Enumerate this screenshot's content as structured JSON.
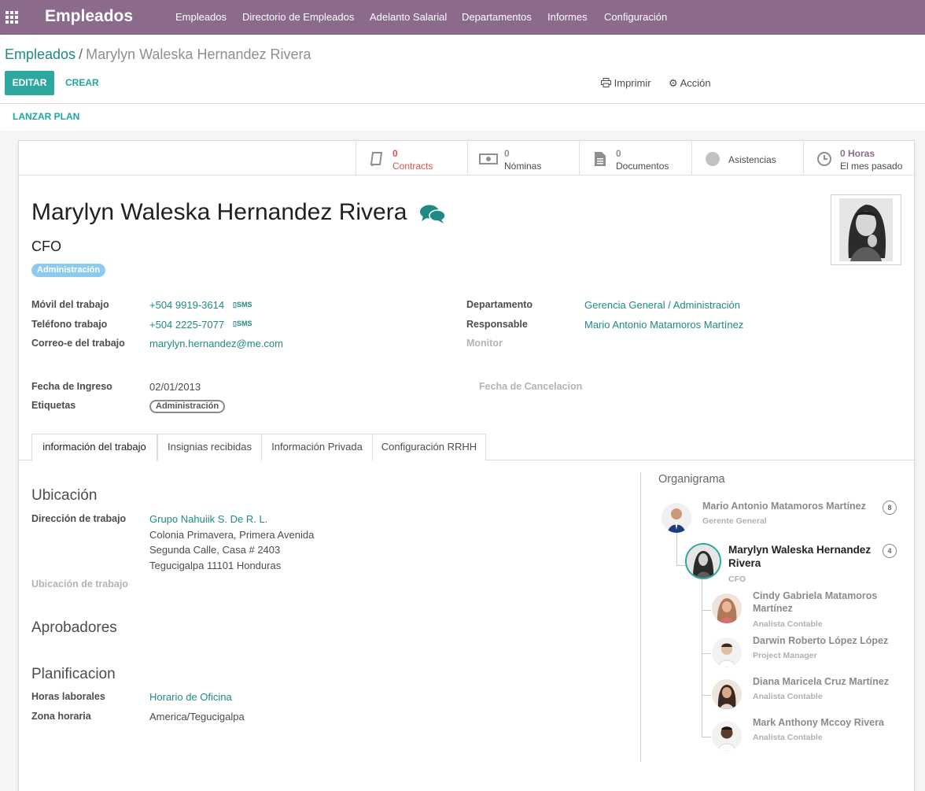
{
  "navbar": {
    "brand": "Empleados",
    "menu": [
      "Empleados",
      "Directorio de Empleados",
      "Adelanto Salarial",
      "Departamentos",
      "Informes",
      "Configuración"
    ]
  },
  "breadcrumb": {
    "parent": "Empleados",
    "separator": "/",
    "current": "Marylyn Waleska Hernandez Rivera"
  },
  "toolbar": {
    "edit": "EDITAR",
    "create": "CREAR",
    "print": "Imprimir",
    "action": "Acción",
    "launch_plan": "LANZAR PLAN"
  },
  "smart_buttons": [
    {
      "number": "0",
      "label": "Contracts",
      "icon": "book-icon",
      "color": "#d9534f"
    },
    {
      "number": "0",
      "label": "Nóminas",
      "icon": "money-icon",
      "color": "#8f8f8f"
    },
    {
      "number": "0",
      "label": "Documentos",
      "icon": "document-icon",
      "color": "#8f8f8f"
    },
    {
      "number": "",
      "label": "Asistencias",
      "icon": "presence-dot-icon",
      "color": "#8f8f8f"
    },
    {
      "number": "0 Horas",
      "label": "El mes pasado",
      "icon": "clock-icon",
      "color": "#8b6a8c"
    }
  ],
  "employee": {
    "name": "Marylyn Waleska Hernandez Rivera",
    "job_title": "CFO",
    "tag": "Administración"
  },
  "fields": {
    "mobile_label": "Móvil del trabajo",
    "mobile": "+504 9919-3614",
    "phone_label": "Teléfono trabajo",
    "phone": "+504 2225-7077",
    "email_label": "Correo-e del trabajo",
    "email": "marylyn.hernandez@me.com",
    "sms": "SMS",
    "department_label": "Departamento",
    "department": "Gerencia General / Administración",
    "manager_label": "Responsable",
    "manager": "Mario Antonio Matamoros Martínez",
    "coach_label": "Monitor",
    "hire_date_label": "Fecha de Ingreso",
    "hire_date": "02/01/2013",
    "tags_label": "Etiquetas",
    "tags": "Administración",
    "cancel_date_label": "Fecha de Cancelacion"
  },
  "tabs": [
    "información del trabajo",
    "Insignias recibidas",
    "Información Privada",
    "Configuración RRHH"
  ],
  "work_info": {
    "location_title": "Ubicación",
    "address_label": "Dirección de trabajo",
    "address_company": "Grupo Nahuiik S. De R. L.",
    "address_lines": [
      "Colonia Primavera, Primera Avenida",
      "Segunda Calle, Casa # 2403",
      "Tegucigalpa 11101 Honduras"
    ],
    "work_location_label": "Ubicación de trabajo",
    "approvers_title": "Aprobadores",
    "planning_title": "Planificacion",
    "hours_label": "Horas laborales",
    "hours": "Horario de Oficina",
    "tz_label": "Zona horaria",
    "tz": "America/Tegucigalpa"
  },
  "org_chart": {
    "title": "Organigrama",
    "manager": {
      "name": "Mario Antonio Matamoros Martínez",
      "job": "Gerente General",
      "count": "8"
    },
    "self": {
      "name": "Marylyn Waleska Hernandez Rivera",
      "job": "CFO",
      "count": "4"
    },
    "subordinates": [
      {
        "name": "Cindy Gabriela Matamoros Martínez",
        "job": "Analista Contable"
      },
      {
        "name": "Darwin Roberto López López",
        "job": "Project Manager"
      },
      {
        "name": "Diana Maricela Cruz Martínez",
        "job": "Analista Contable"
      },
      {
        "name": "Mark Anthony Mccoy Rivera",
        "job": "Analista Contable"
      }
    ]
  },
  "colors": {
    "navbar": "#8b6a8c",
    "primary": "#2ea79e",
    "link": "#1f8a84",
    "tag": "#8ccbee"
  }
}
